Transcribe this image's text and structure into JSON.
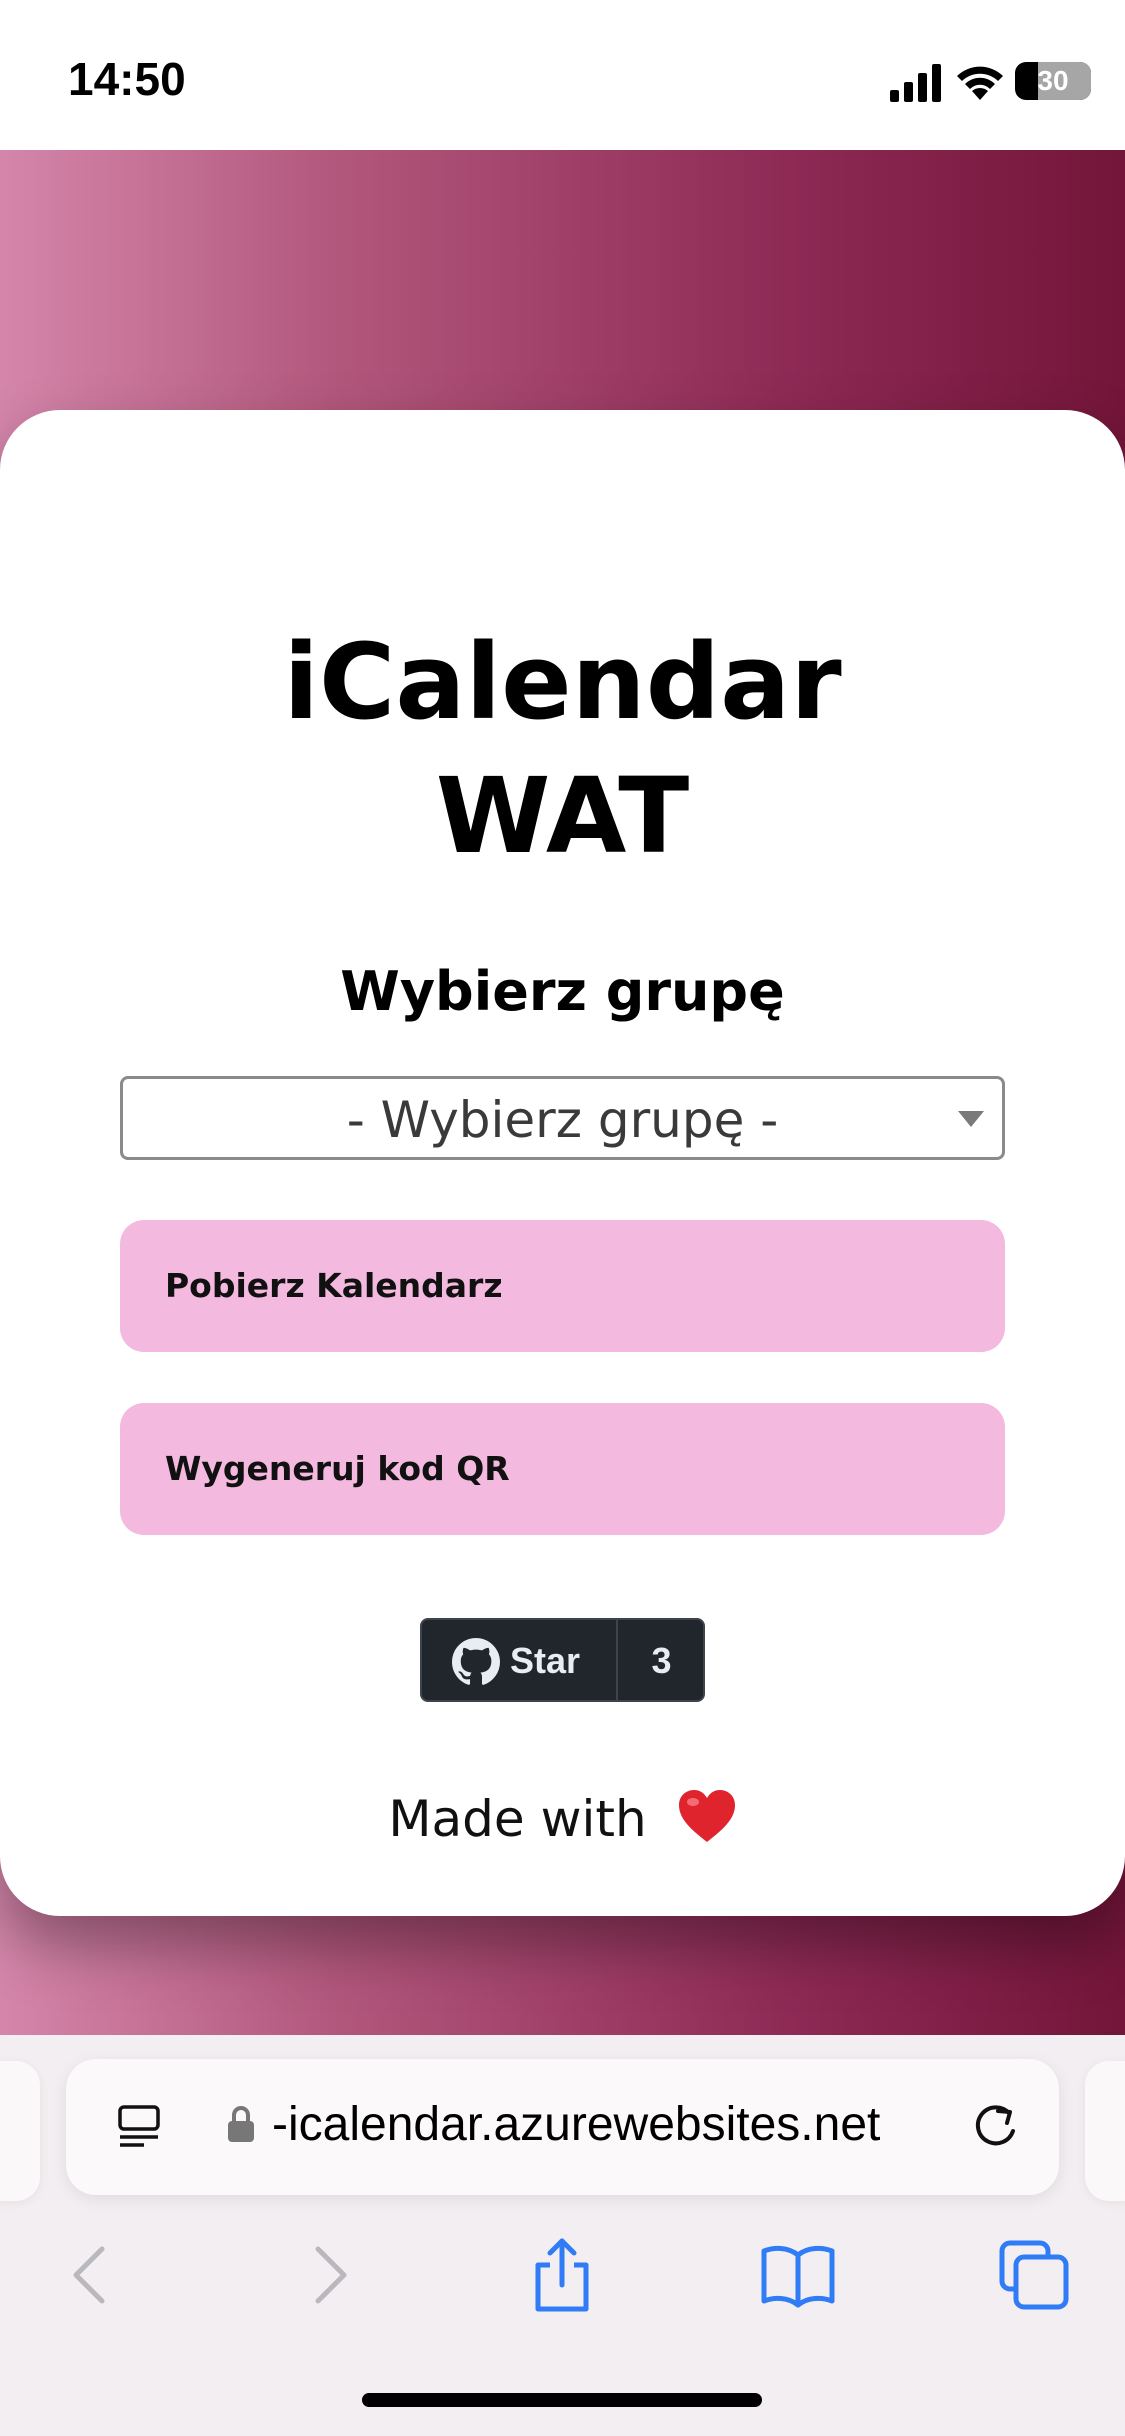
{
  "status_bar": {
    "time": "14:50",
    "battery": "30"
  },
  "card": {
    "title_line1": "iCalendar",
    "title_line2": "WAT",
    "section_title": "Wybierz grupę",
    "group_select": {
      "selected": "- Wybierz grupę -"
    },
    "buttons": {
      "download_label": "Pobierz Kalendarz",
      "qr_label": "Wygeneruj kod QR"
    },
    "github_star": {
      "label": "Star",
      "count": "3"
    },
    "footer": "Made with"
  },
  "browser": {
    "url": "-icalendar.azurewebsites.net"
  },
  "colors": {
    "button_bg": "#f3b9df",
    "gradient_start": "#d486aa",
    "gradient_end": "#731539"
  },
  "icons": [
    "signal-icon",
    "wifi-icon",
    "battery-icon",
    "chevron-down-icon",
    "github-icon",
    "heart-icon",
    "reader-icon",
    "lock-icon",
    "reload-icon",
    "back-icon",
    "forward-icon",
    "share-icon",
    "bookmarks-icon",
    "tabs-icon"
  ]
}
